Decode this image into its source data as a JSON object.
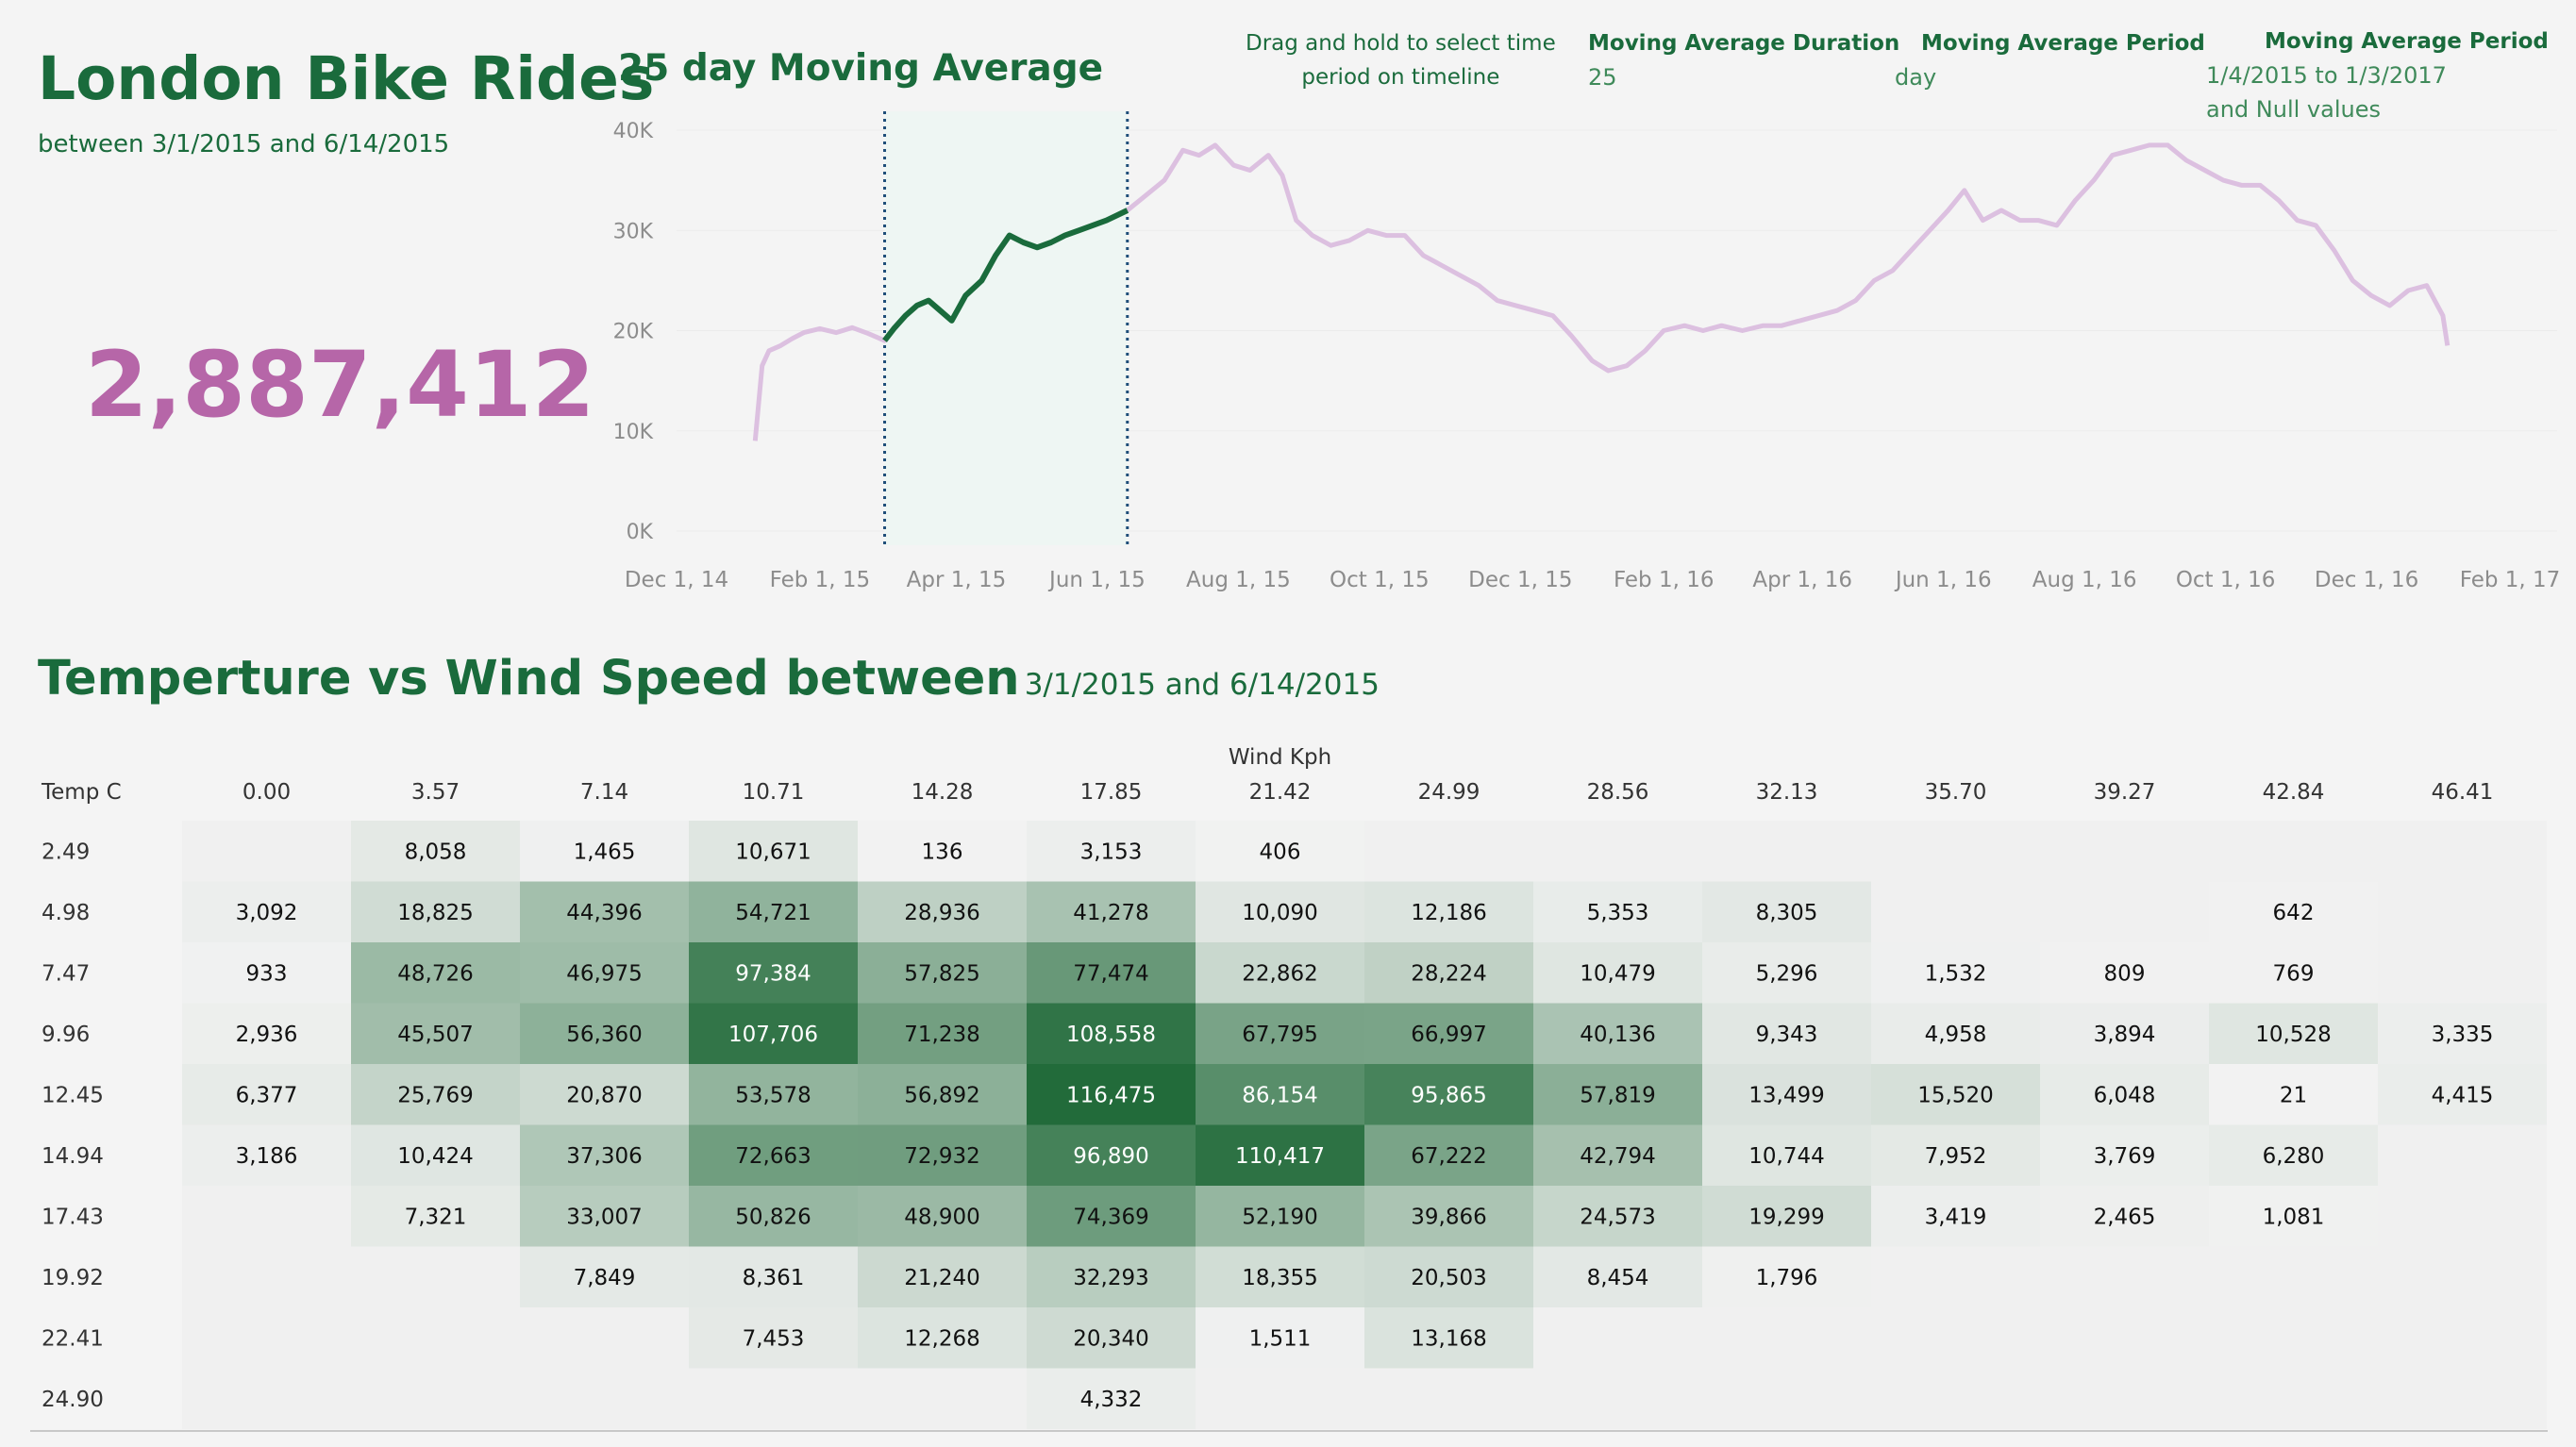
{
  "header": {
    "title": "London Bike Rides",
    "subtitle": "between 3/1/2015 and 6/14/2015",
    "total_rides": "2,887,412"
  },
  "controls": {
    "instruction": [
      "Drag and hold to select time",
      "period on timeline"
    ],
    "duration_label": "Moving Average Duration",
    "duration_value": "25",
    "period_label": "Moving Average Period",
    "period_value": "day",
    "range_label": "Moving Average Period",
    "range_value": [
      "1/4/2015 to 1/3/2017",
      "and Null values"
    ]
  },
  "heatmap_title": {
    "main": "Temperture vs Wind Speed between",
    "range": "3/1/2015 and 6/14/2015"
  },
  "colors": {
    "brand_green": "#1a6b3c",
    "total_purple": "#b666a8",
    "line_faded": "#dcc0e0",
    "line_selected": "#1a6b3c",
    "selection_fill": "#eef6f3",
    "selection_border": "#1f4e79"
  },
  "chart_data": [
    {
      "type": "line",
      "title": "25 day Moving Average",
      "xlabel": "",
      "ylabel": "",
      "ylim": [
        0,
        40000
      ],
      "yticks": [
        0,
        10000,
        20000,
        30000,
        40000
      ],
      "ytick_labels": [
        "0K",
        "10K",
        "20K",
        "30K",
        "40K"
      ],
      "xticks": [
        "2014-12-01",
        "2015-02-01",
        "2015-04-01",
        "2015-06-01",
        "2015-08-01",
        "2015-10-01",
        "2015-12-01",
        "2016-02-01",
        "2016-04-01",
        "2016-06-01",
        "2016-08-01",
        "2016-10-01",
        "2016-12-01",
        "2017-02-01"
      ],
      "xtick_labels": [
        "Dec 1, 14",
        "Feb 1, 15",
        "Apr 1, 15",
        "Jun 1, 15",
        "Aug 1, 15",
        "Oct 1, 15",
        "Dec 1, 15",
        "Feb 1, 16",
        "Apr 1, 16",
        "Jun 1, 16",
        "Aug 1, 16",
        "Oct 1, 16",
        "Dec 1, 16",
        "Feb 1, 17"
      ],
      "xrange": [
        "2014-12-01",
        "2017-02-01"
      ],
      "selection": [
        "2015-03-01",
        "2015-06-14"
      ],
      "series": [
        {
          "points": [
            [
              "2015-01-04",
              9000
            ],
            [
              "2015-01-07",
              16500
            ],
            [
              "2015-01-10",
              18000
            ],
            [
              "2015-01-15",
              18500
            ],
            [
              "2015-01-20",
              19200
            ],
            [
              "2015-01-25",
              19800
            ],
            [
              "2015-02-01",
              20200
            ],
            [
              "2015-02-08",
              19800
            ],
            [
              "2015-02-15",
              20300
            ],
            [
              "2015-02-22",
              19700
            ],
            [
              "2015-03-01",
              19000
            ],
            [
              "2015-03-05",
              20200
            ],
            [
              "2015-03-10",
              21500
            ],
            [
              "2015-03-15",
              22500
            ],
            [
              "2015-03-20",
              23000
            ],
            [
              "2015-03-25",
              22000
            ],
            [
              "2015-03-30",
              21000
            ],
            [
              "2015-04-05",
              23500
            ],
            [
              "2015-04-12",
              25000
            ],
            [
              "2015-04-18",
              27500
            ],
            [
              "2015-04-24",
              29500
            ],
            [
              "2015-04-30",
              28800
            ],
            [
              "2015-05-06",
              28300
            ],
            [
              "2015-05-12",
              28800
            ],
            [
              "2015-05-18",
              29500
            ],
            [
              "2015-05-24",
              30000
            ],
            [
              "2015-05-30",
              30500
            ],
            [
              "2015-06-05",
              31000
            ],
            [
              "2015-06-14",
              32000
            ],
            [
              "2015-06-22",
              33500
            ],
            [
              "2015-06-30",
              35000
            ],
            [
              "2015-07-08",
              38000
            ],
            [
              "2015-07-15",
              37500
            ],
            [
              "2015-07-22",
              38500
            ],
            [
              "2015-07-30",
              36500
            ],
            [
              "2015-08-06",
              36000
            ],
            [
              "2015-08-14",
              37500
            ],
            [
              "2015-08-20",
              35500
            ],
            [
              "2015-08-26",
              31000
            ],
            [
              "2015-09-02",
              29500
            ],
            [
              "2015-09-10",
              28500
            ],
            [
              "2015-09-18",
              29000
            ],
            [
              "2015-09-26",
              30000
            ],
            [
              "2015-10-04",
              29500
            ],
            [
              "2015-10-12",
              29500
            ],
            [
              "2015-10-20",
              27500
            ],
            [
              "2015-10-28",
              26500
            ],
            [
              "2015-11-05",
              25500
            ],
            [
              "2015-11-13",
              24500
            ],
            [
              "2015-11-21",
              23000
            ],
            [
              "2015-11-29",
              22500
            ],
            [
              "2015-12-07",
              22000
            ],
            [
              "2015-12-15",
              21500
            ],
            [
              "2015-12-23",
              19500
            ],
            [
              "2016-01-01",
              17000
            ],
            [
              "2016-01-08",
              16000
            ],
            [
              "2016-01-16",
              16500
            ],
            [
              "2016-01-24",
              18000
            ],
            [
              "2016-02-01",
              20000
            ],
            [
              "2016-02-10",
              20500
            ],
            [
              "2016-02-18",
              20000
            ],
            [
              "2016-02-26",
              20500
            ],
            [
              "2016-03-06",
              20000
            ],
            [
              "2016-03-15",
              20500
            ],
            [
              "2016-03-23",
              20500
            ],
            [
              "2016-03-31",
              21000
            ],
            [
              "2016-04-08",
              21500
            ],
            [
              "2016-04-16",
              22000
            ],
            [
              "2016-04-24",
              23000
            ],
            [
              "2016-05-02",
              25000
            ],
            [
              "2016-05-10",
              26000
            ],
            [
              "2016-05-18",
              28000
            ],
            [
              "2016-05-26",
              30000
            ],
            [
              "2016-06-03",
              32000
            ],
            [
              "2016-06-10",
              34000
            ],
            [
              "2016-06-18",
              31000
            ],
            [
              "2016-06-26",
              32000
            ],
            [
              "2016-07-04",
              31000
            ],
            [
              "2016-07-12",
              31000
            ],
            [
              "2016-07-20",
              30500
            ],
            [
              "2016-07-28",
              33000
            ],
            [
              "2016-08-05",
              35000
            ],
            [
              "2016-08-13",
              37500
            ],
            [
              "2016-08-21",
              38000
            ],
            [
              "2016-08-29",
              38500
            ],
            [
              "2016-09-06",
              38500
            ],
            [
              "2016-09-14",
              37000
            ],
            [
              "2016-09-22",
              36000
            ],
            [
              "2016-09-30",
              35000
            ],
            [
              "2016-10-08",
              34500
            ],
            [
              "2016-10-16",
              34500
            ],
            [
              "2016-10-24",
              33000
            ],
            [
              "2016-11-01",
              31000
            ],
            [
              "2016-11-09",
              30500
            ],
            [
              "2016-11-17",
              28000
            ],
            [
              "2016-11-25",
              25000
            ],
            [
              "2016-12-03",
              23500
            ],
            [
              "2016-12-11",
              22500
            ],
            [
              "2016-12-19",
              24000
            ],
            [
              "2016-12-27",
              24500
            ],
            [
              "2017-01-03",
              21500
            ],
            [
              "2017-01-05",
              18500
            ]
          ]
        }
      ]
    },
    {
      "type": "heatmap",
      "xlabel": "Wind Kph",
      "ylabel": "Temp C",
      "x_categories": [
        "0.00",
        "3.57",
        "7.14",
        "10.71",
        "14.28",
        "17.85",
        "21.42",
        "24.99",
        "28.56",
        "32.13",
        "35.70",
        "39.27",
        "42.84",
        "46.41"
      ],
      "y_categories": [
        "2.49",
        "4.98",
        "7.47",
        "9.96",
        "12.45",
        "14.94",
        "17.43",
        "19.92",
        "22.41",
        "24.90"
      ],
      "values": [
        [
          null,
          8058,
          1465,
          10671,
          136,
          3153,
          406,
          null,
          null,
          null,
          null,
          null,
          null,
          null
        ],
        [
          3092,
          18825,
          44396,
          54721,
          28936,
          41278,
          10090,
          12186,
          5353,
          8305,
          null,
          null,
          642,
          null
        ],
        [
          933,
          48726,
          46975,
          97384,
          57825,
          77474,
          22862,
          28224,
          10479,
          5296,
          1532,
          809,
          769,
          null
        ],
        [
          2936,
          45507,
          56360,
          107706,
          71238,
          108558,
          67795,
          66997,
          40136,
          9343,
          4958,
          3894,
          10528,
          3335
        ],
        [
          6377,
          25769,
          20870,
          53578,
          56892,
          116475,
          86154,
          95865,
          57819,
          13499,
          15520,
          6048,
          21,
          4415
        ],
        [
          3186,
          10424,
          37306,
          72663,
          72932,
          96890,
          110417,
          67222,
          42794,
          10744,
          7952,
          3769,
          6280,
          null
        ],
        [
          null,
          7321,
          33007,
          50826,
          48900,
          74369,
          52190,
          39866,
          24573,
          19299,
          3419,
          2465,
          1081,
          null
        ],
        [
          null,
          null,
          7849,
          8361,
          21240,
          32293,
          18355,
          20503,
          8454,
          1796,
          null,
          null,
          null,
          null
        ],
        [
          null,
          null,
          null,
          7453,
          12268,
          20340,
          1511,
          13168,
          null,
          null,
          null,
          null,
          null,
          null
        ],
        [
          null,
          null,
          null,
          null,
          null,
          4332,
          null,
          null,
          null,
          null,
          null,
          null,
          null,
          null
        ]
      ]
    }
  ]
}
